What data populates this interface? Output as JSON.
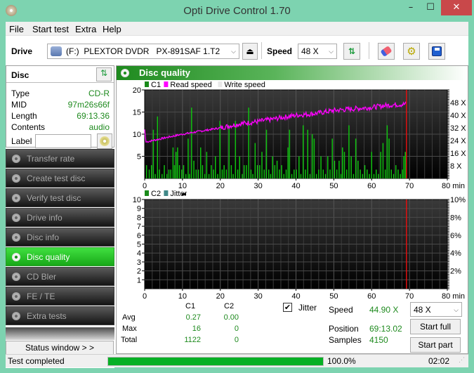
{
  "window": {
    "title": "Opti Drive Control 1.70",
    "minimize": "–",
    "maximize": "☐",
    "close": "✕"
  },
  "menu": [
    "File",
    "Start test",
    "Extra",
    "Help"
  ],
  "toolbar": {
    "drive_label": "Drive",
    "drive_value": "(F:)  PLEXTOR DVDR   PX-891SAF 1.T2",
    "speed_label": "Speed",
    "speed_value": "48 X",
    "icons": [
      "drive-icon",
      "eject-icon",
      "refresh-icon",
      "erase-icon",
      "settings-icon",
      "save-icon"
    ]
  },
  "disc": {
    "header": "Disc",
    "rows": [
      {
        "key": "Type",
        "value": "CD-R"
      },
      {
        "key": "MID",
        "value": "97m26s66f"
      },
      {
        "key": "Length",
        "value": "69:13.36"
      },
      {
        "key": "Contents",
        "value": "audio"
      }
    ],
    "label_key": "Label",
    "label_value": ""
  },
  "nav": [
    {
      "label": "Transfer rate",
      "active": false
    },
    {
      "label": "Create test disc",
      "active": false
    },
    {
      "label": "Verify test disc",
      "active": false
    },
    {
      "label": "Drive info",
      "active": false
    },
    {
      "label": "Disc info",
      "active": false
    },
    {
      "label": "Disc quality",
      "active": true
    },
    {
      "label": "CD Bler",
      "active": false
    },
    {
      "label": "FE / TE",
      "active": false
    },
    {
      "label": "Extra tests",
      "active": false
    }
  ],
  "status_window_btn": "Status window > >",
  "panel_title": "Disc quality",
  "chart_data": [
    {
      "type": "bar",
      "title": "C1 / Read speed",
      "legend": [
        {
          "name": "C1",
          "color": "#1a8a1a"
        },
        {
          "name": "Read speed",
          "color": "#ff00ff"
        },
        {
          "name": "Write speed",
          "color": "#e8e8e8"
        }
      ],
      "xlabel": "min",
      "xlim": [
        0,
        80
      ],
      "x_ticks": [
        "0",
        "10",
        "20",
        "30",
        "40",
        "50",
        "60",
        "70",
        "80 min"
      ],
      "ylim": [
        0,
        20
      ],
      "y_ticks": [
        "5",
        "10",
        "15",
        "20"
      ],
      "y2lim": [
        0,
        56
      ],
      "y2_ticks": [
        "8 X",
        "16 X",
        "24 X",
        "32 X",
        "40 X",
        "48 X"
      ],
      "end_marker_min": 69.2,
      "series": [
        {
          "name": "C1",
          "x": [
            0.5,
            1.2,
            1.8,
            2.3,
            2.8,
            3.4,
            3.9,
            4.6,
            5.2,
            5.9,
            6.4,
            6.9,
            7.5,
            7.9,
            8.3,
            8.7,
            9.2,
            9.8,
            10.3,
            10.9,
            11.5,
            11.9,
            12.4,
            13.0,
            13.6,
            14.2,
            14.8,
            15.3,
            15.9,
            16.4,
            17.0,
            17.6,
            18.2,
            18.7,
            19.3,
            19.9,
            20.5,
            21.0,
            21.6,
            22.3,
            22.9,
            23.4,
            24.0,
            24.6,
            25.1,
            25.8,
            26.3,
            26.9,
            27.5,
            28.1,
            28.6,
            29.2,
            29.8,
            30.4,
            31.0,
            31.6,
            32.2,
            32.8,
            33.3,
            33.8,
            34.4,
            35.0,
            35.6,
            36.2,
            36.8,
            37.4,
            37.9,
            38.3,
            38.9,
            39.5,
            40.1,
            40.8,
            41.3,
            41.9,
            42.5,
            43.1,
            43.7,
            44.3,
            44.8,
            45.4,
            46.0,
            46.6,
            47.2,
            47.8,
            48.4,
            49.0,
            49.6,
            50.2,
            50.8,
            51.4,
            51.9,
            52.3,
            52.8,
            53.4,
            54.0,
            54.6,
            55.2,
            55.8,
            56.4,
            57.0,
            57.6,
            58.2,
            58.8,
            59.4,
            60.0,
            60.6,
            61.2,
            61.8,
            62.4,
            63.0,
            63.6,
            64.1,
            64.6,
            65.2,
            65.8,
            66.4,
            67.0,
            67.6,
            68.1,
            68.5,
            68.9
          ],
          "values": [
            3,
            2,
            3,
            11,
            1,
            14,
            2,
            1,
            3,
            1,
            2,
            2,
            7,
            3,
            6,
            7,
            3,
            2,
            3,
            1,
            9,
            1,
            16,
            4,
            2,
            2,
            7,
            3,
            1,
            6,
            1,
            3,
            2,
            5,
            1,
            13,
            2,
            3,
            2,
            12,
            3,
            1,
            13,
            2,
            5,
            1,
            3,
            3,
            16,
            2,
            1,
            8,
            3,
            3,
            6,
            2,
            11,
            2,
            1,
            5,
            3,
            4,
            2,
            3,
            1,
            2,
            7,
            11,
            1,
            2,
            2,
            5,
            1,
            12,
            2,
            11,
            1,
            10,
            9,
            1,
            2,
            5,
            2,
            1,
            5,
            2,
            9,
            4,
            2,
            4,
            1,
            7,
            6,
            2,
            12,
            5,
            1,
            9,
            4,
            2,
            1,
            3,
            2,
            1,
            6,
            1,
            2,
            1,
            6,
            8,
            2,
            12,
            9,
            2,
            1,
            3,
            2,
            1,
            2,
            5,
            6
          ],
          "color": "#10c010"
        },
        {
          "name": "Read speed",
          "unit": "X",
          "x": [
            0,
            0.3,
            5,
            10,
            15,
            20,
            25,
            30,
            35,
            40,
            45,
            50,
            55,
            60,
            65,
            69.2
          ],
          "values": [
            31,
            23,
            25.5,
            28,
            30,
            32,
            34.5,
            36,
            38,
            40,
            41,
            43,
            44,
            45,
            46.5,
            47
          ],
          "color": "#ff00ff"
        }
      ]
    },
    {
      "type": "bar",
      "title": "C2 / Jitter",
      "legend": [
        {
          "name": "C2",
          "color": "#1a8a1a"
        },
        {
          "name": "Jitter",
          "color": "#408888"
        }
      ],
      "xlabel": "min",
      "xlim": [
        0,
        80
      ],
      "x_ticks": [
        "0",
        "10",
        "20",
        "30",
        "40",
        "50",
        "60",
        "70",
        "80 min"
      ],
      "ylim": [
        0,
        10
      ],
      "y_ticks": [
        "1",
        "2",
        "3",
        "4",
        "5",
        "6",
        "7",
        "8",
        "9",
        "10"
      ],
      "y2lim": [
        0,
        10
      ],
      "y2_ticks": [
        "2%",
        "4%",
        "6%",
        "8%",
        "10%"
      ],
      "end_marker_min": 69.2,
      "series": [
        {
          "name": "C2",
          "x": [],
          "values": []
        },
        {
          "name": "Jitter",
          "x": [],
          "values": []
        }
      ]
    }
  ],
  "stats": {
    "col_c1": "C1",
    "col_c2": "C2",
    "rows": [
      {
        "label": "Avg",
        "c1": "0.27",
        "c2": "0.00"
      },
      {
        "label": "Max",
        "c1": "16",
        "c2": "0"
      },
      {
        "label": "Total",
        "c1": "1122",
        "c2": "0"
      }
    ],
    "jitter_label": "Jitter",
    "jitter_checked": true
  },
  "readout": {
    "speed_label": "Speed",
    "speed_value": "44.90 X",
    "position_label": "Position",
    "position_value": "69:13.02",
    "samples_label": "Samples",
    "samples_value": "4150",
    "speed_select": "48 X",
    "start_full": "Start full",
    "start_part": "Start part"
  },
  "statusbar": {
    "message": "Test completed",
    "progress_percent": 100.0,
    "progress_text": "100.0%",
    "elapsed": "02:02"
  }
}
